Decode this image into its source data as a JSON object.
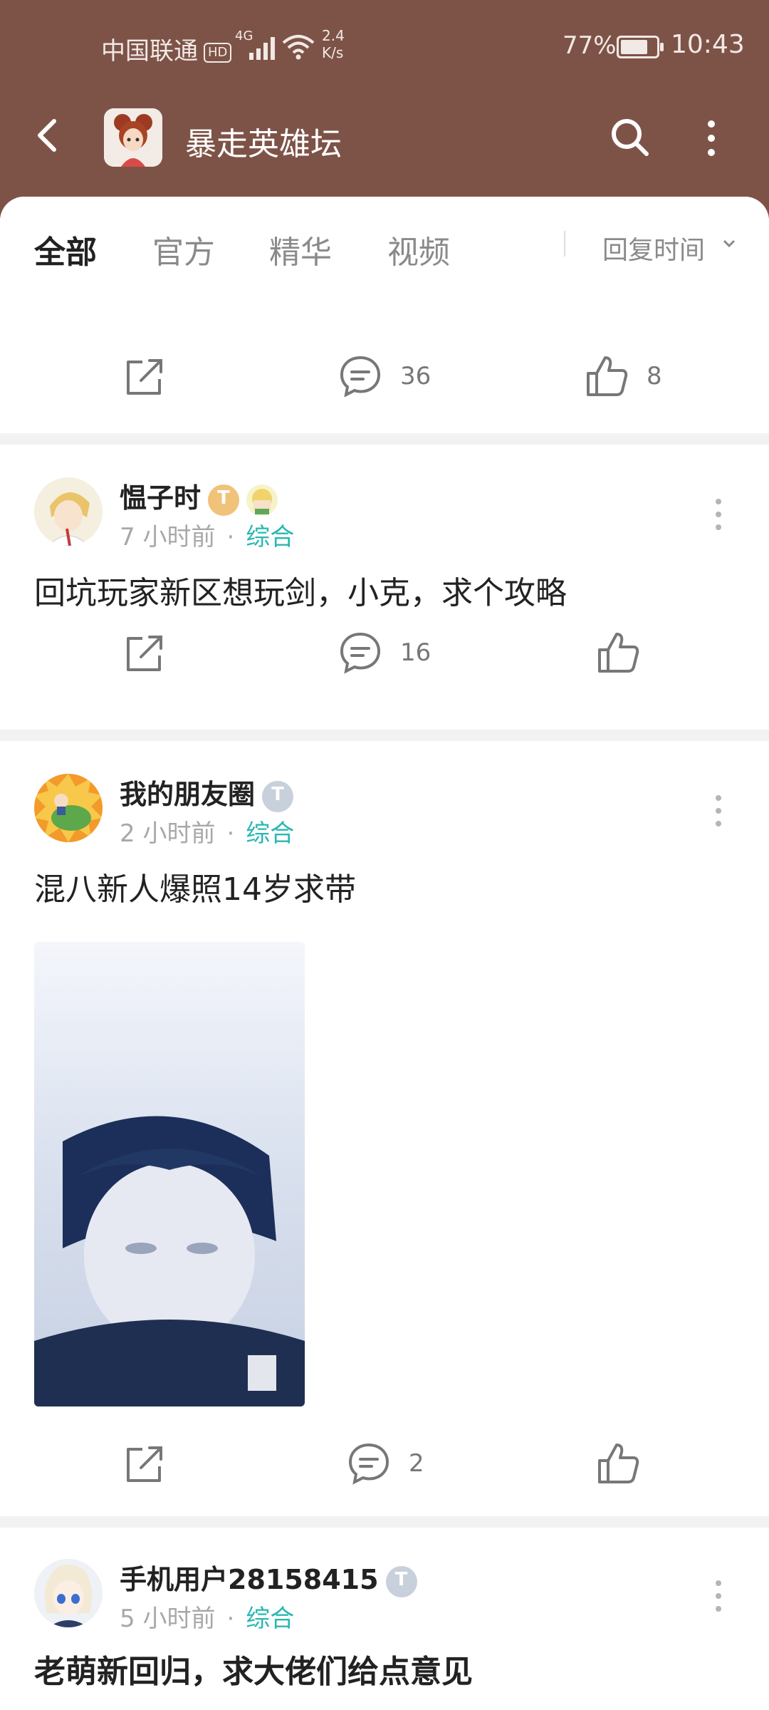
{
  "status_bar": {
    "carrier": "中国联通",
    "hd": "HD",
    "network": "4G",
    "speed_value": "2.4",
    "speed_unit": "K/s",
    "battery": "77%",
    "battery_level": 0.77,
    "time": "10:43"
  },
  "header": {
    "title": "暴走英雄坛",
    "back_icon": "back-arrow-icon",
    "search_icon": "search-icon",
    "more_icon": "more-vertical-icon",
    "bg_color": "#7e5347"
  },
  "tabs": {
    "items": [
      "全部",
      "官方",
      "精华",
      "视频"
    ],
    "active_index": 0,
    "sort_label": "回复时间"
  },
  "feed": {
    "first_actions": {
      "comments": "36",
      "likes": "8"
    },
    "posts": [
      {
        "username": "愠子时",
        "level_badge": "T",
        "time": "7 小时前",
        "category": "综合",
        "text": "回坑玩家新区想玩剑，小克，求个攻略",
        "comments": "16",
        "likes": ""
      },
      {
        "username": "我的朋友圈",
        "level_badge": "T",
        "time": "2 小时前",
        "category": "综合",
        "text": "混八新人爆照14岁求带",
        "comments": "2",
        "likes": ""
      },
      {
        "username": "手机用户28158415",
        "level_badge": "T",
        "time": "5 小时前",
        "category": "综合",
        "text": "老萌新回归，求大佬们给点意见"
      }
    ],
    "dot": "·"
  },
  "colors": {
    "accent_teal": "#2bb7b3",
    "badge_gold": "#f0c27a",
    "badge_silver": "#c8d0dc"
  }
}
